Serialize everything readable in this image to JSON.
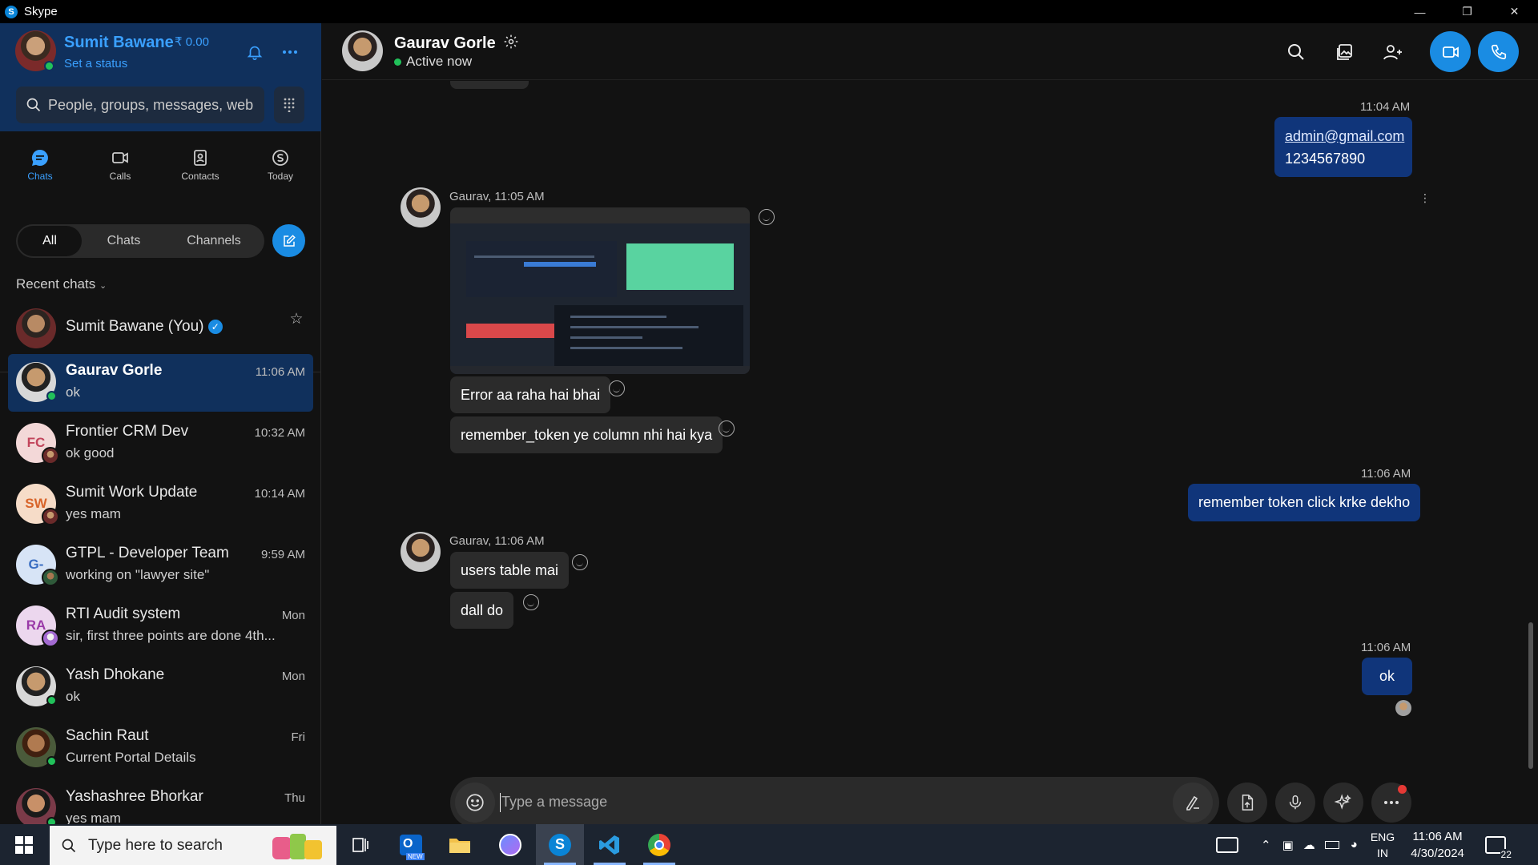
{
  "window": {
    "title": "Skype"
  },
  "profile": {
    "name": "Sumit Bawane",
    "credit": "₹ 0.00",
    "status": "Set a status"
  },
  "search": {
    "placeholder": "People, groups, messages, web"
  },
  "nav": [
    {
      "label": "Chats",
      "icon": "chat-bubble-icon"
    },
    {
      "label": "Calls",
      "icon": "video-camera-icon"
    },
    {
      "label": "Contacts",
      "icon": "contact-book-icon"
    },
    {
      "label": "Today",
      "icon": "skype-logo-icon"
    }
  ],
  "filters": [
    "All",
    "Chats",
    "Channels"
  ],
  "recent": {
    "header": "Recent chats",
    "pinned": {
      "name": "Sumit Bawane (You)"
    },
    "chats": [
      {
        "name": "Gaurav Gorle",
        "message": "ok",
        "time": "11:06 AM",
        "active": true
      },
      {
        "name": "Frontier CRM Dev",
        "message": "ok good",
        "time": "10:32 AM",
        "initials": "FC",
        "color": "#f3d8d8"
      },
      {
        "name": "Sumit Work Update",
        "message": "yes mam",
        "time": "10:14 AM",
        "initials": "SW",
        "color": "#f6dcc8"
      },
      {
        "name": "GTPL - Developer Team",
        "message": "working on \"lawyer site\"",
        "time": "9:59 AM",
        "initials": "G-",
        "color": "#d7e4f6"
      },
      {
        "name": "RTI Audit system",
        "message": "sir, first three points are done 4th...",
        "time": "Mon",
        "initials": "RA",
        "color": "#ecd7ee"
      },
      {
        "name": "Yash Dhokane",
        "message": "ok",
        "time": "Mon"
      },
      {
        "name": "Sachin Raut",
        "message": "Current Portal Details",
        "time": "Fri"
      },
      {
        "name": "Yashashree Bhorkar",
        "message": "yes mam",
        "time": "Thu"
      }
    ]
  },
  "conversation": {
    "name": "Gaurav Gorle",
    "status": "Active now",
    "messages": {
      "t1": "11:04 AM",
      "email": "admin@gmail.com",
      "phone": "1234567890",
      "sender1": "Gaurav, 11:05 AM",
      "in1": "Error aa raha hai bhai",
      "in2": "remember_token ye column nhi hai kya",
      "t2": "11:06 AM",
      "out1": "remember token click krke dekho",
      "sender2": "Gaurav, 11:06 AM",
      "in3": "users table mai",
      "in4": "dall do",
      "t3": "11:06 AM",
      "out2": "ok"
    },
    "composer_placeholder": "Type a message"
  },
  "taskbar": {
    "search_placeholder": "Type here to search",
    "lang1": "ENG",
    "lang2": "IN",
    "time": "11:06 AM",
    "date": "4/30/2024",
    "notifications": "22",
    "outlook_badge": "NEW"
  },
  "colors": {
    "accent": "#1a8ce3",
    "sidebar_top": "#10305c",
    "outgoing_bubble": "#10357a",
    "incoming_bubble": "#2b2b2b"
  }
}
